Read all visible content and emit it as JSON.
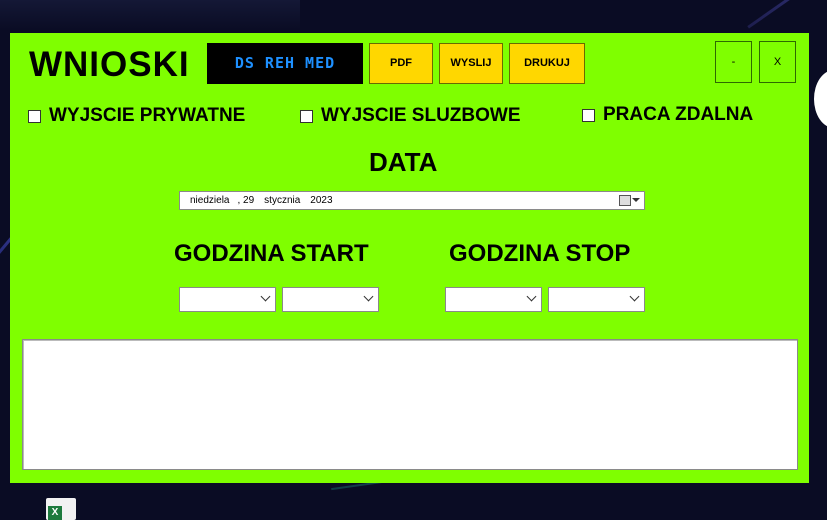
{
  "app": {
    "title": "WNIOSKI",
    "brand": "DS REH MED"
  },
  "toolbar": {
    "pdf_label": "PDF",
    "send_label": "WYSLIJ",
    "print_label": "DRUKUJ",
    "minimize_label": "-",
    "close_label": "X"
  },
  "options": {
    "private_exit": "WYJSCIE PRYWATNE",
    "business_exit": "WYJSCIE SLUZBOWE",
    "remote_work": "PRACA ZDALNA"
  },
  "date": {
    "heading": "DATA",
    "weekday": "niedziela",
    "day": ", 29",
    "month": "stycznia",
    "year": "2023"
  },
  "time": {
    "start_heading": "GODZINA START",
    "stop_heading": "GODZINA STOP"
  },
  "colors": {
    "window_bg": "#7fff00",
    "button_yellow": "#ffd700",
    "brand_text": "#1e90ff"
  }
}
